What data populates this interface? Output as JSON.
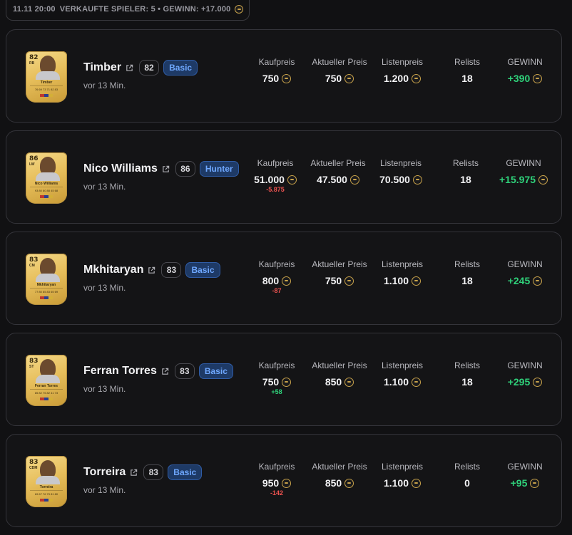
{
  "summary": {
    "date": "11.11 20:00",
    "text": "VERKAUFTE SPIELER: 5 • GEWINN: +17.000",
    "coin_icon": "coin-icon"
  },
  "labels": {
    "buy": "Kaufpreis",
    "current": "Aktueller Preis",
    "list": "Listenpreis",
    "relists": "Relists",
    "profit": "GEWINN"
  },
  "colors": {
    "profit_green": "#2fd17a",
    "loss_red": "#ef5350",
    "tag_blue": "#6fa8ff",
    "coin_gold": "#c8a24a"
  },
  "players": [
    {
      "name": "Timber",
      "rating": "82",
      "tag": "Basic",
      "time": "vor 13 Min.",
      "card": {
        "rating": "82",
        "pos": "RB",
        "name": "Timber",
        "stats": "76 69 73 71 82 83"
      },
      "buy": "750",
      "buy_diff": "",
      "current": "750",
      "list": "1.200",
      "relists": "18",
      "profit": "+390"
    },
    {
      "name": "Nico Williams",
      "rating": "86",
      "tag": "Hunter",
      "time": "vor 13 Min.",
      "card": {
        "rating": "86",
        "pos": "LW",
        "name": "Nico Williams",
        "stats": "93 80 80 88 45 68"
      },
      "buy": "51.000",
      "buy_diff": "-5.875",
      "current": "47.500",
      "list": "70.500",
      "relists": "18",
      "profit": "+15.975"
    },
    {
      "name": "Mkhitaryan",
      "rating": "83",
      "tag": "Basic",
      "time": "vor 13 Min.",
      "card": {
        "rating": "83",
        "pos": "CM",
        "name": "Mkhitaryan",
        "stats": "77 80 85 83 65 69"
      },
      "buy": "800",
      "buy_diff": "-87",
      "current": "750",
      "list": "1.100",
      "relists": "18",
      "profit": "+245"
    },
    {
      "name": "Ferran Torres",
      "rating": "83",
      "tag": "Basic",
      "time": "vor 13 Min.",
      "card": {
        "rating": "83",
        "pos": "ST",
        "name": "Ferran Torres",
        "stats": "85 82 75 82 41 73"
      },
      "buy": "750",
      "buy_diff": "+58",
      "current": "850",
      "list": "1.100",
      "relists": "18",
      "profit": "+295"
    },
    {
      "name": "Torreira",
      "rating": "83",
      "tag": "Basic",
      "time": "vor 13 Min.",
      "card": {
        "rating": "83",
        "pos": "CDM",
        "name": "Torreira",
        "stats": "69 67 76 79 81 80"
      },
      "buy": "950",
      "buy_diff": "-142",
      "current": "850",
      "list": "1.100",
      "relists": "0",
      "profit": "+95"
    }
  ]
}
